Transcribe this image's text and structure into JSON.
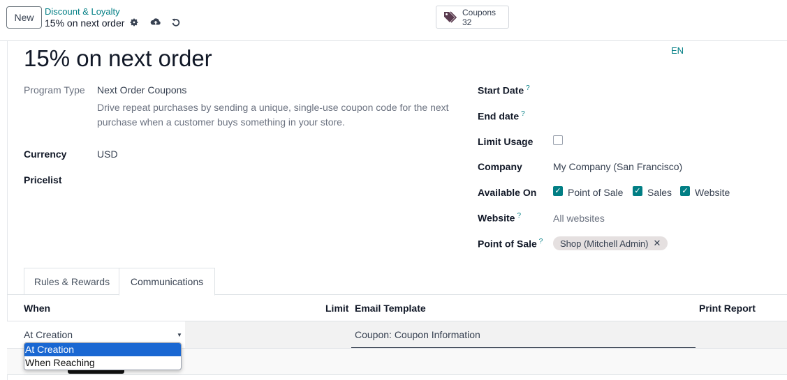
{
  "control_panel": {
    "new_button": "New",
    "breadcrumb": "Discount & Loyalty",
    "record_name": "15% on next order",
    "smart_button": {
      "label": "Coupons",
      "value": "32"
    }
  },
  "form": {
    "title": "15% on next order",
    "language": "EN",
    "left": {
      "program_type": {
        "label": "Program Type",
        "value": "Next Order Coupons"
      },
      "description": "Drive repeat purchases by sending a unique, single-use coupon code for the next purchase when a customer buys something in your store.",
      "currency": {
        "label": "Currency",
        "value": "USD"
      },
      "pricelist": {
        "label": "Pricelist"
      }
    },
    "right": {
      "start_date": {
        "label": "Start Date",
        "help": "?"
      },
      "end_date": {
        "label": "End date",
        "help": "?"
      },
      "limit_usage": {
        "label": "Limit Usage",
        "checked": false
      },
      "company": {
        "label": "Company",
        "value": "My Company (San Francisco)"
      },
      "available_on": {
        "label": "Available On",
        "options": [
          {
            "label": "Point of Sale",
            "checked": true
          },
          {
            "label": "Sales",
            "checked": true
          },
          {
            "label": "Website",
            "checked": true
          }
        ]
      },
      "website": {
        "label": "Website",
        "help": "?",
        "placeholder": "All websites"
      },
      "point_of_sale": {
        "label": "Point of Sale",
        "help": "?",
        "tag": "Shop (Mitchell Admin)"
      }
    }
  },
  "tabs": [
    {
      "label": "Rules & Rewards",
      "active": false
    },
    {
      "label": "Communications",
      "active": true
    }
  ],
  "communications": {
    "columns": {
      "when": "When",
      "limit": "Limit",
      "email_template": "Email Template",
      "print_report": "Print Report"
    },
    "row": {
      "when": "At Creation",
      "email_template": "Coupon: Coupon Information"
    },
    "dropdown_options": [
      "At Creation",
      "When Reaching"
    ],
    "dropdown_selected": "At Creation"
  },
  "colors": {
    "accent": "#017e84",
    "dropdown_highlight": "#1967d2"
  }
}
